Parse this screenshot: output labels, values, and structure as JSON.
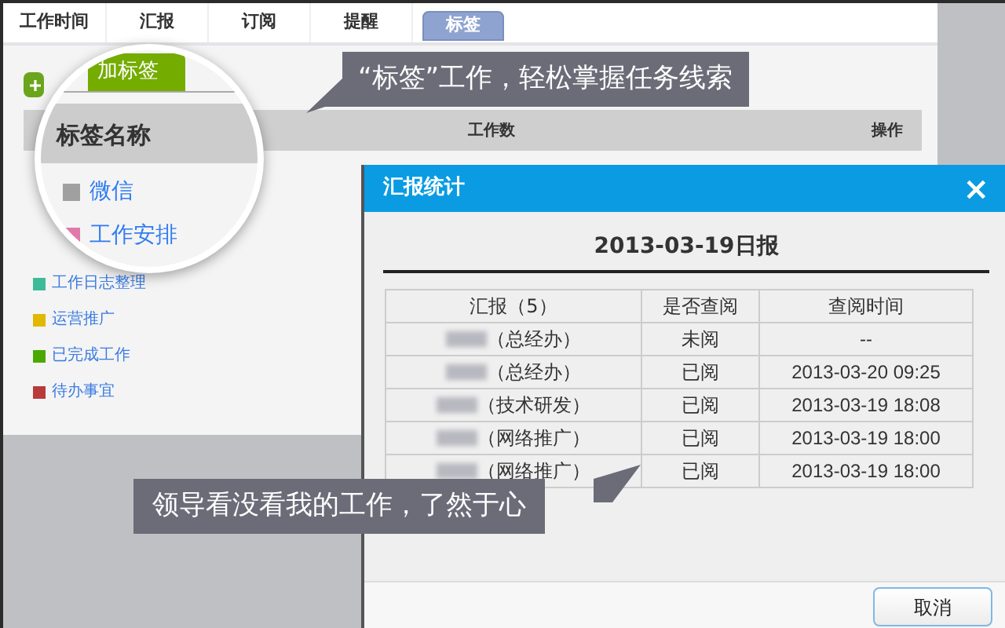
{
  "tabs": [
    {
      "label": "工作时间",
      "selected": false
    },
    {
      "label": "汇报",
      "selected": false
    },
    {
      "label": "订阅",
      "selected": false
    },
    {
      "label": "提醒",
      "selected": false
    },
    {
      "label": "标签",
      "selected": true
    }
  ],
  "tag_table": {
    "columns": [
      "工作数",
      "操作"
    ],
    "tags": [
      {
        "label": "工作日志整理",
        "color": "#3dbb98"
      },
      {
        "label": "运营推广",
        "color": "#e0b800"
      },
      {
        "label": "已完成工作",
        "color": "#4aa800"
      },
      {
        "label": "待办事宜",
        "color": "#b83a3a"
      }
    ]
  },
  "magnifier": {
    "add_button": "加标签",
    "column": "标签名称",
    "tags": [
      {
        "label": "微信",
        "color": "#a0a0a0"
      },
      {
        "label": "工作安排",
        "color": "#e07aaa"
      }
    ]
  },
  "callouts": [
    "“标签”工作，轻松掌握任务线索",
    "领导看没看我的工作，了然于心"
  ],
  "dialog": {
    "title": "汇报统计",
    "close": "×",
    "heading": "2013-03-19日报",
    "columns": [
      "汇报（5）",
      "是否查阅",
      "查阅时间"
    ],
    "rows": [
      [
        "（总经办）",
        "未阅",
        "--"
      ],
      [
        "（总经办）",
        "已阅",
        "2013-03-20 09:25"
      ],
      [
        "（技术研发）",
        "已阅",
        "2013-03-19 18:08"
      ],
      [
        "（网络推广）",
        "已阅",
        "2013-03-19 18:00"
      ],
      [
        "（网络推广）",
        "已阅",
        "2013-03-19 18:00"
      ]
    ],
    "cancel": "取消"
  }
}
